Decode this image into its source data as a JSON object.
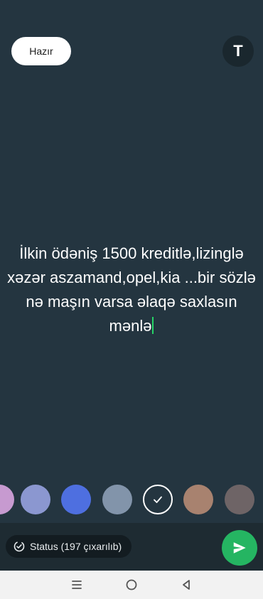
{
  "toolbar": {
    "done_label": "Hazır",
    "text_tool_label": "T"
  },
  "status": {
    "text": "İlkin ödəniş 1500 kreditlə,lizinglə xəzər aszamand,opel,kia ...bir sözlə nə maşın varsa əlaqə saxlasın mənlə",
    "caret_color": "#25d366"
  },
  "background_color": "#243540",
  "color_swatches": [
    {
      "color": "#c79ad0",
      "selected": false
    },
    {
      "color": "#8b97d0",
      "selected": false
    },
    {
      "color": "#4e6fe0",
      "selected": false
    },
    {
      "color": "#8294aa",
      "selected": false
    },
    {
      "color": "#243540",
      "selected": true
    },
    {
      "color": "#a8826f",
      "selected": false
    },
    {
      "color": "#6e6466",
      "selected": false
    }
  ],
  "audience": {
    "label": "Status (197 çıxarılıb)",
    "icon": "status-privacy-icon"
  },
  "send": {
    "icon": "send-icon",
    "color": "#25b562"
  },
  "system_nav": {
    "icons": [
      "recent-apps-icon",
      "home-icon",
      "back-icon"
    ]
  }
}
